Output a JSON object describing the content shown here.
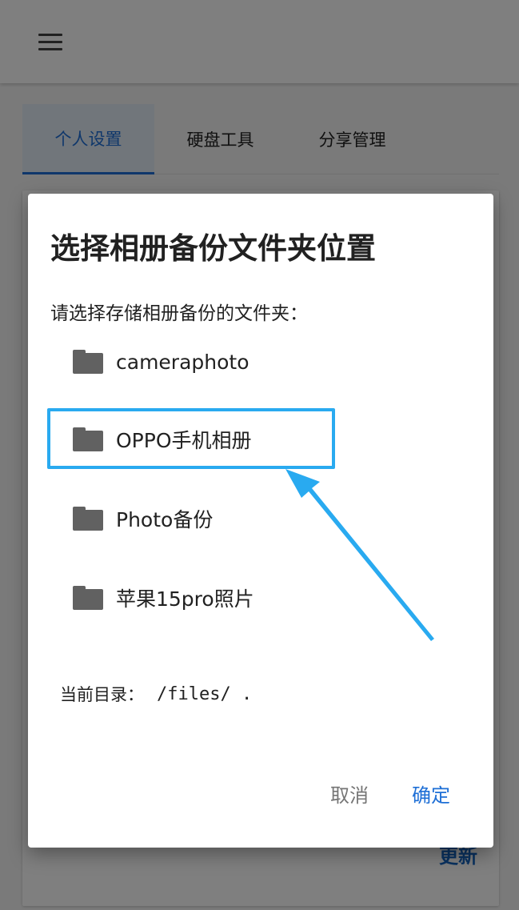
{
  "tabs": [
    {
      "label": "个人设置"
    },
    {
      "label": "硬盘工具"
    },
    {
      "label": "分享管理"
    }
  ],
  "background": {
    "update_label": "更新"
  },
  "dialog": {
    "title": "选择相册备份文件夹位置",
    "prompt": "请选择存储相册备份的文件夹：",
    "folders": [
      {
        "name": "cameraphoto",
        "icon": "folder-icon"
      },
      {
        "name": "OPPO手机相册",
        "icon": "folder-icon"
      },
      {
        "name": "Photo备份",
        "icon": "folder-icon"
      },
      {
        "name": "苹果15pro照片",
        "icon": "folder-icon"
      }
    ],
    "current_dir_label": "当前目录：",
    "current_dir_value": "/files/ .",
    "cancel_label": "取消",
    "ok_label": "确定"
  },
  "colors": {
    "accent": "#1e6fd6",
    "highlight": "#29aaf0",
    "folder": "#616161"
  }
}
